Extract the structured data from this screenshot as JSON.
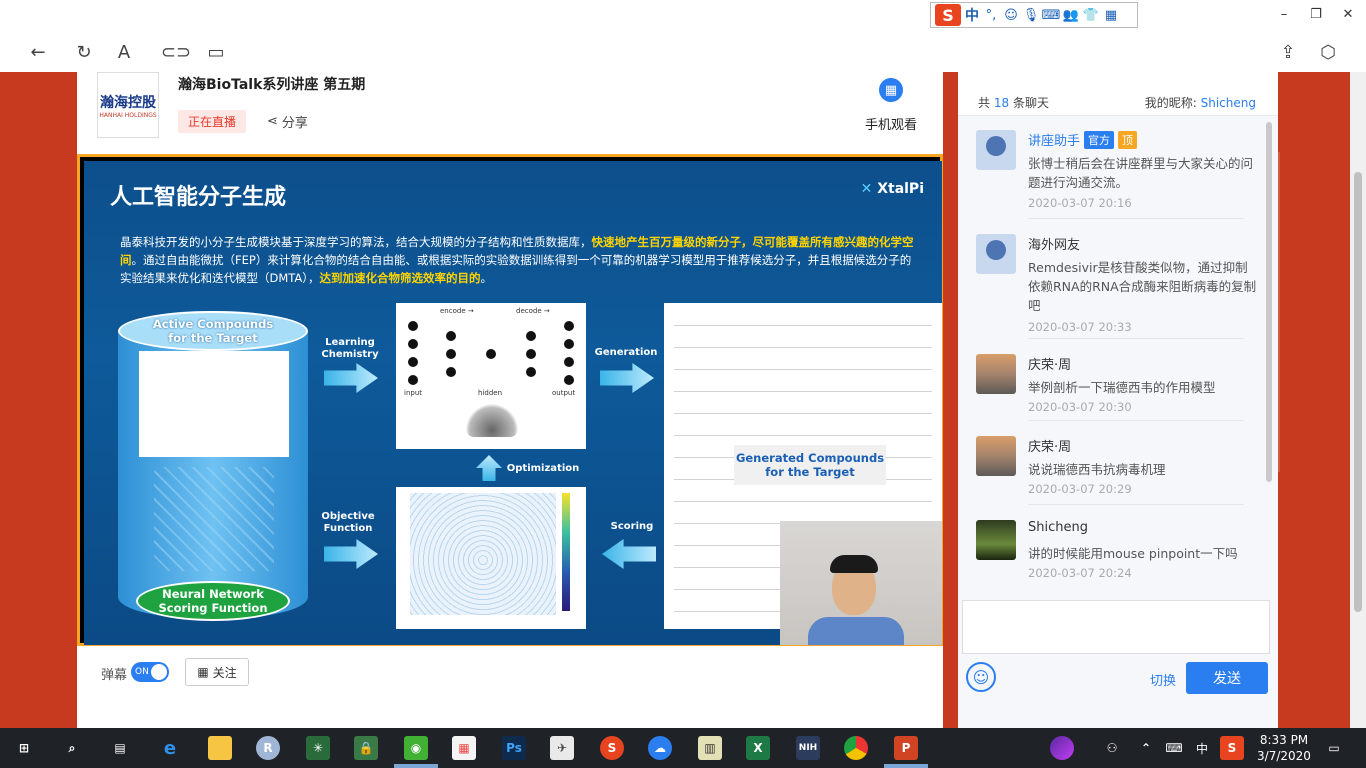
{
  "browser": {
    "back_icon": "arrow-left-icon",
    "refresh_icon": "refresh-icon",
    "read_aloud_icon": "A",
    "link_icon": "link-icon",
    "tabs_icon": "tabs-icon",
    "ime": {
      "logo": "S",
      "lang": "中",
      "punct": "°,"
    },
    "window_controls": {
      "minimize": "–",
      "restore": "❐",
      "close": "✕"
    }
  },
  "header": {
    "logo_text": "瀚海控股",
    "logo_sub": "HANHAI HOLDINGS",
    "title": "瀚海BioTalk系列讲座 第五期",
    "live_badge": "正在直播",
    "share_label": "分享",
    "mobile_label": "手机观看"
  },
  "slide": {
    "title": "人工智能分子生成",
    "brand_x": "✕",
    "brand_name": "XtalPi",
    "para_1": "晶泰科技开发的小分子生成模块基于深度学习的算法，结合大规模的分子结构和性质数据库，",
    "para_hl_1": "快速地产生百万量级的新分子，尽可能覆盖所有感兴趣的化学空间",
    "para_2": "。通过自由能微扰（FEP）来计算化合物的结合自由能、或根据实际的实验数据训练得到一个可靠的机器学习模型用于推荐候选分子，并且根据候选分子的实验结果来优化和迭代模型（DMTA），",
    "para_hl_2": "达到加速化合物筛选效率的目的",
    "para_end": "。",
    "active_compounds": "Active Compounds\nfor the Target",
    "neural_network": "Neural Network\nScoring Function",
    "learning_chemistry": "Learning\nChemistry",
    "generation": "Generation",
    "optimization": "Optimization",
    "objective_function": "Objective\nFunction",
    "scoring": "Scoring",
    "generated_compounds": "Generated Compounds\nfor the Target",
    "vae_encode": "encode →",
    "vae_decode": "decode →",
    "vae_input": "input",
    "vae_hidden": "hidden",
    "vae_output": "output"
  },
  "controls": {
    "barrage_label": "弹幕",
    "toggle_state": "ON",
    "follow_label": "关注"
  },
  "chat": {
    "count_prefix": "共",
    "count": "18",
    "count_suffix": "条聊天",
    "nick_label": "我的昵称:",
    "nick": "Shicheng",
    "messages": [
      {
        "name": "讲座助手",
        "tag_official": "官方",
        "tag_top": "顶",
        "text": "张博士稍后会在讲座群里与大家关心的问题进行沟通交流。",
        "time": "2020-03-07 20:16"
      },
      {
        "name": "海外网友",
        "text": "Remdesivir是核苷酸类似物，通过抑制依赖RNA的RNA合成酶来阻断病毒的复制吧",
        "time": "2020-03-07 20:33"
      },
      {
        "name": "庆荣·周",
        "text": "举例剖析一下瑞德西韦的作用模型",
        "time": "2020-03-07 20:30"
      },
      {
        "name": "庆荣·周",
        "text": "说说瑞德西韦抗病毒机理",
        "time": "2020-03-07 20:29"
      },
      {
        "name": "Shicheng",
        "text": "讲的时候能用mouse pinpoint一下吗",
        "time": "2020-03-07 20:24"
      }
    ],
    "switch_label": "切换",
    "send_label": "发送"
  },
  "taskbar": {
    "apps": [
      "start",
      "search",
      "task-view",
      "edge",
      "explorer",
      "r",
      "app-green",
      "app-lock",
      "wechat",
      "store",
      "photoshop",
      "app-kite",
      "app-sogou",
      "baidu-netdisk",
      "app-chart",
      "excel",
      "nih",
      "chrome",
      "powerpoint"
    ],
    "lang": "中",
    "time": "8:33 PM",
    "date": "3/7/2020"
  }
}
